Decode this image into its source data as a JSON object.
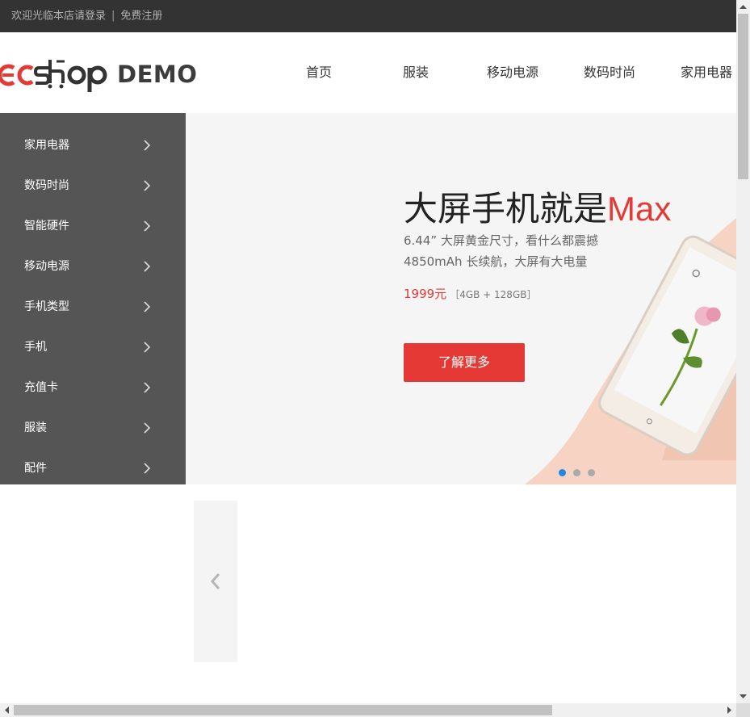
{
  "topbar": {
    "welcome_text": "欢迎光临本店请登录",
    "separator": "|",
    "register_link": "免费注册"
  },
  "header": {
    "logo_text": "ECSHOP",
    "logo_demo": "DEMO",
    "nav": [
      "首页",
      "服装",
      "移动电源",
      "数码时尚",
      "家用电器"
    ]
  },
  "sidebar": {
    "items": [
      {
        "label": "家用电器"
      },
      {
        "label": "数码时尚"
      },
      {
        "label": "智能硬件"
      },
      {
        "label": "移动电源"
      },
      {
        "label": "手机类型"
      },
      {
        "label": "手机"
      },
      {
        "label": "充值卡"
      },
      {
        "label": "服装"
      },
      {
        "label": "配件"
      }
    ],
    "background": "#555555"
  },
  "banner": {
    "title_main": "大屏手机就是",
    "title_accent": "Max",
    "subtitle_1": "6.44” 大屏黄金尺寸，看什么都震撼",
    "subtitle_2": "4850mAh 长续航，大屏有大电量",
    "price": "1999元",
    "spec": "［4GB + 128GB］",
    "button_label": "了解更多",
    "accent_color": "#e53935",
    "slides_total": 3,
    "active_slide": 1
  },
  "colors": {
    "topbar_bg": "#333333",
    "sidebar_bg": "#555555",
    "banner_bg": "#f5f5f5",
    "accent": "#e53935",
    "dot_active": "#1e88e5"
  },
  "icons": {
    "sidebar_chevron": "chevron-right-icon",
    "carousel_prev": "chevron-left-icon"
  }
}
